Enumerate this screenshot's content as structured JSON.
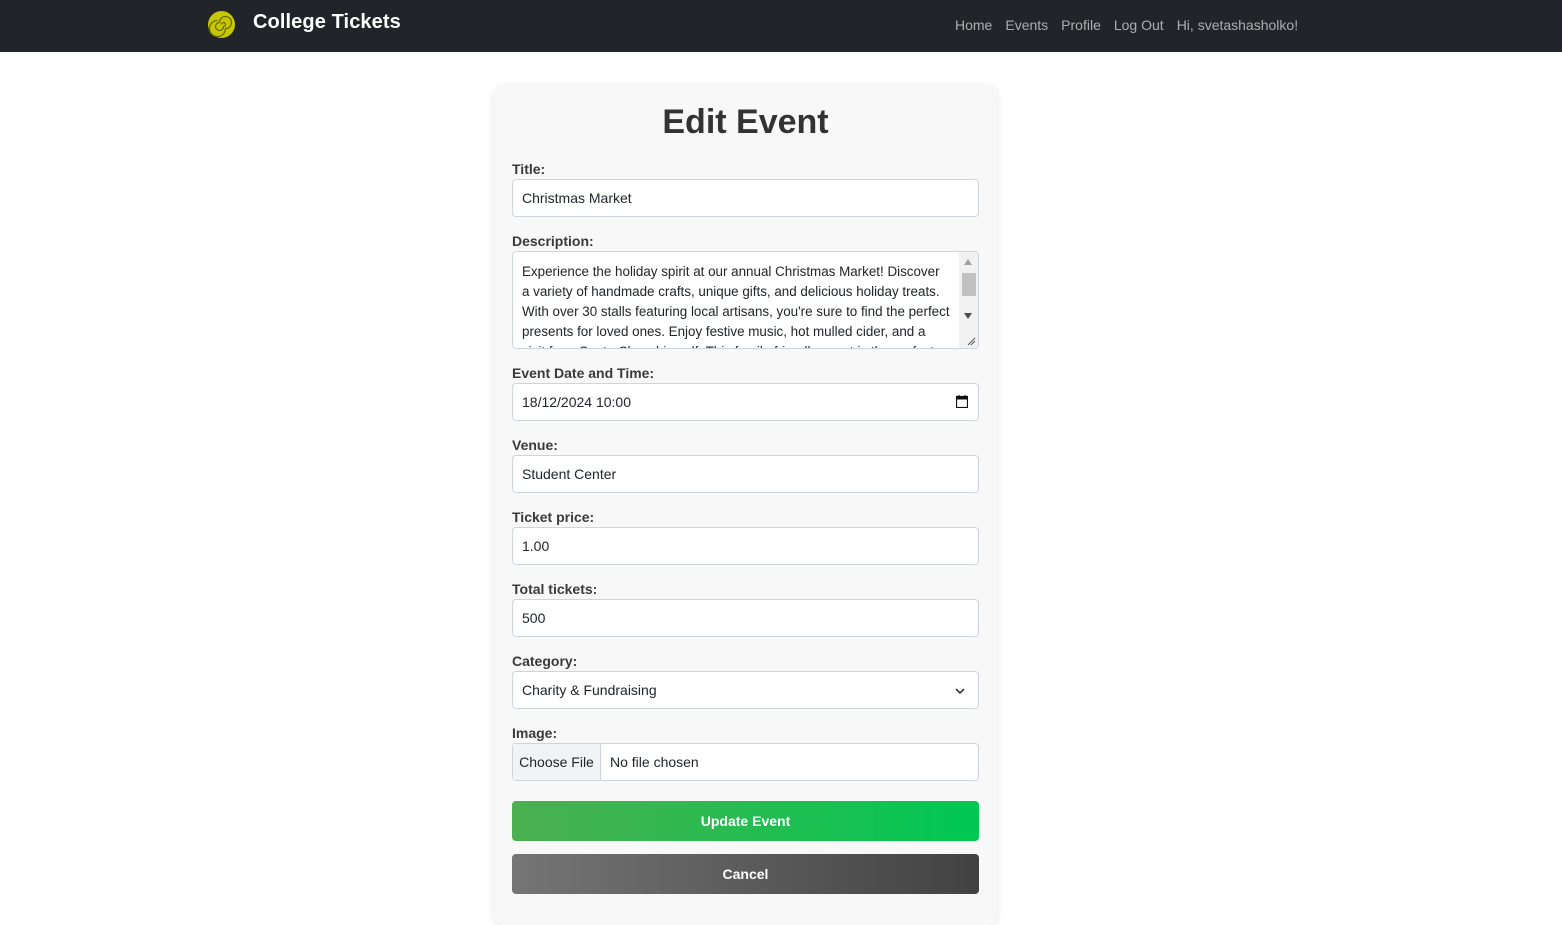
{
  "navbar": {
    "brand": "College Tickets",
    "logo_icon": "spiral-logo-icon",
    "links": [
      "Home",
      "Events",
      "Profile",
      "Log Out"
    ],
    "greeting": "Hi, svetashasholko!"
  },
  "form": {
    "heading": "Edit Event",
    "title": {
      "label": "Title:",
      "value": "Christmas Market"
    },
    "description": {
      "label": "Description:",
      "value": "Experience the holiday spirit at our annual Christmas Market! Discover a variety of handmade crafts, unique gifts, and delicious holiday treats. With over 30 stalls featuring local artisans, you're sure to find the perfect presents for loved ones. Enjoy festive music, hot mulled cider, and a visit from Santa Claus himself. This family-friendly event is the perfect way to"
    },
    "datetime": {
      "label": "Event Date and Time:",
      "value": "18/12/2024 10:00",
      "icon": "calendar-icon"
    },
    "venue": {
      "label": "Venue:",
      "value": "Student Center"
    },
    "price": {
      "label": "Ticket price:",
      "value": "1.00"
    },
    "tickets": {
      "label": "Total tickets:",
      "value": "500"
    },
    "category": {
      "label": "Category:",
      "value": "Charity & Fundraising",
      "icon": "chevron-down-icon"
    },
    "image": {
      "label": "Image:",
      "button": "Choose File",
      "status": "No file chosen"
    },
    "update_button": "Update Event",
    "cancel_button": "Cancel"
  },
  "colors": {
    "navbar_bg": "#212529",
    "logo": "#c8c800",
    "update_gradient": [
      "#4caf50",
      "#00c853"
    ],
    "cancel_gradient": [
      "#757575",
      "#424242"
    ]
  }
}
